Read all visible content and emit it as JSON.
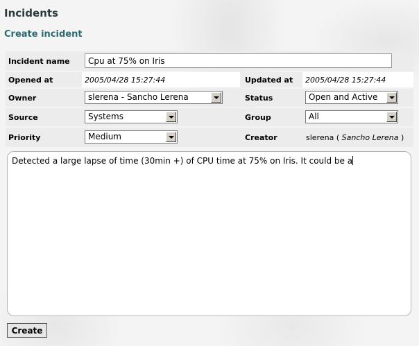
{
  "page": {
    "title": "Incidents",
    "subtitle": "Create incident"
  },
  "form": {
    "incident_name": {
      "label": "Incident name",
      "value": "Cpu at 75% on Iris"
    },
    "opened_at": {
      "label": "Opened at",
      "value": "2005/04/28 15:27:44"
    },
    "updated_at": {
      "label": "Updated at",
      "value": "2005/04/28 15:27:44"
    },
    "owner": {
      "label": "Owner",
      "value": "slerena - Sancho Lerena"
    },
    "status": {
      "label": "Status",
      "value": "Open and Active"
    },
    "source": {
      "label": "Source",
      "value": "Systems"
    },
    "group": {
      "label": "Group",
      "value": "All"
    },
    "priority": {
      "label": "Priority",
      "value": "Medium"
    },
    "creator": {
      "label": "Creator",
      "user": "slerena",
      "open": " ( ",
      "name": "Sancho Lerena",
      "close": " )"
    },
    "description": "Detected a large lapse of time (30min +) of CPU time at 75% on Iris. It could be a",
    "submit_label": "Create"
  },
  "colors": {
    "title": "#2c3b3b",
    "subtitle": "#2a6a6e",
    "row_bg": "#ececec",
    "page_bg": "#f4f4f4"
  }
}
